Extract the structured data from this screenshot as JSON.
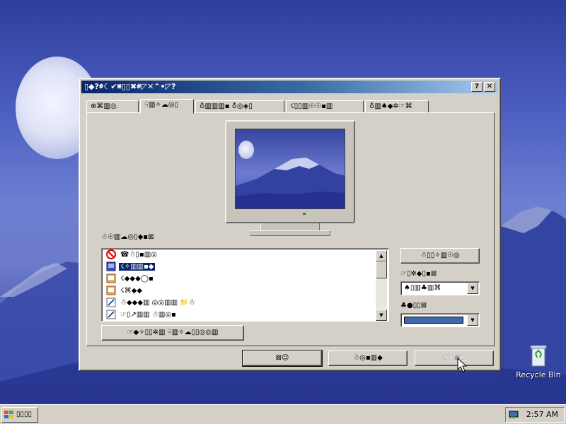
{
  "desktop": {
    "recycle_bin_label": "Recycle Bin"
  },
  "window": {
    "title": "▯◆?␥☾✔␧▯▯✖␥◸✕⌃•◸?",
    "help_button": "?",
    "close_button": "✕",
    "tabs": [
      {
        "label": "⊕⌘▥◎.",
        "active": false
      },
      {
        "label": "☟▥✧☁◎▯",
        "active": true
      },
      {
        "label": "♁▥▥▥▪ ♁◎◈▯",
        "active": false
      },
      {
        "label": "☇▯▯▥☉☉▪▥",
        "active": false
      },
      {
        "label": "♁▥♠◆✲☞⌘",
        "active": false
      }
    ],
    "wallpaper_group_label": "☃☉▥☁◎▯◆▪⊠",
    "wallpaper_list": [
      {
        "icon": "none-icon",
        "label": "☎☃▯▪▥◎",
        "selected": false
      },
      {
        "icon": "wallpaper-bmp-icon",
        "label": "☇✧▥▥▪◆",
        "selected": true
      },
      {
        "icon": "wallpaper-bmp-icon",
        "label": "☇◆◆◆◯▪",
        "selected": false
      },
      {
        "icon": "wallpaper-bmp-icon",
        "label": "☇⌘◆◆",
        "selected": false
      },
      {
        "icon": "wallpaper-html-icon",
        "label": "☃◆◆◆▥ ◎◎▥▥ 📁☃",
        "selected": false
      },
      {
        "icon": "wallpaper-html-icon",
        "label": "☞▯↗▥▥ ☃▥◎▪",
        "selected": false
      }
    ],
    "browse_button": "☃▯▯✧▥☉◎",
    "picture_display_label": "☞▯✲◆▯▪⊠",
    "picture_display_value": "♠▯▥♣▥⌘",
    "color_label": "♣●▯▯⊠",
    "color_value": "#3e68ac",
    "pattern_button": "☞◆✧▯▯✲▥ ☟▥✧☁▯▯◎◎▥",
    "ok_button": "⊠☺",
    "cancel_button": "☃◎▪▥◆",
    "apply_button": "☇▯▯●⊡"
  },
  "taskbar": {
    "start_label": "▯▯▯▯",
    "clock": "2:57 AM"
  }
}
